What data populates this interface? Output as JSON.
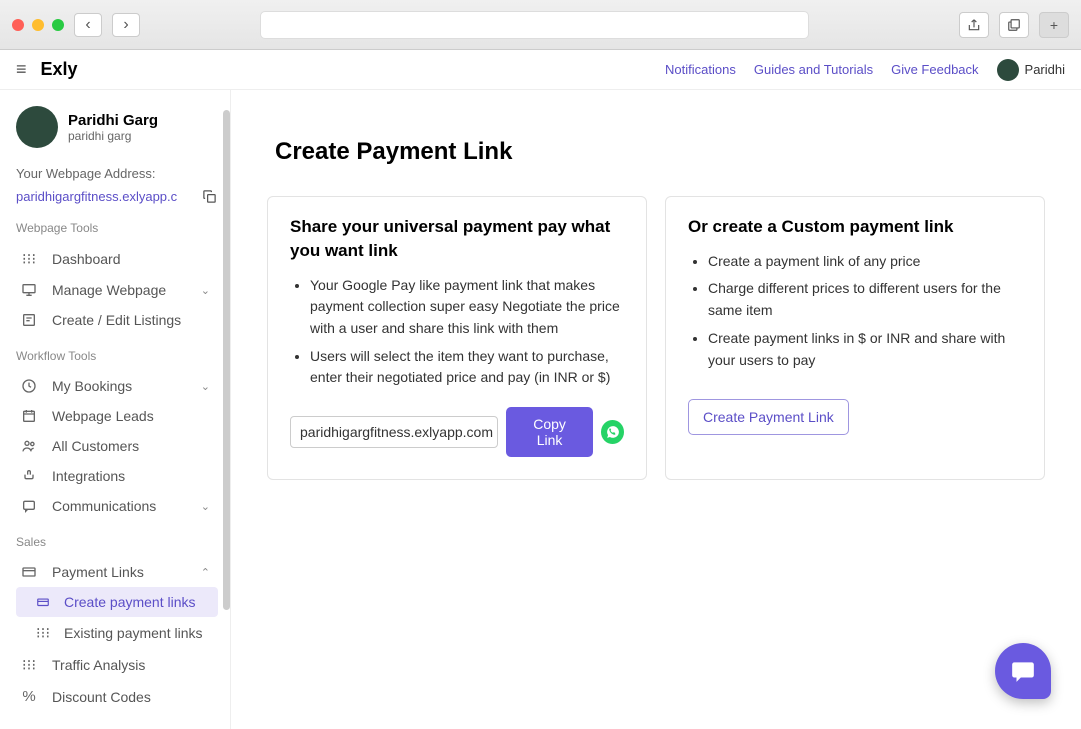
{
  "brand": "Exly",
  "topbar": {
    "links": [
      "Notifications",
      "Guides and Tutorials",
      "Give Feedback"
    ],
    "user": "Paridhi"
  },
  "sidebar": {
    "profile": {
      "name": "Paridhi Garg",
      "sub": "paridhi garg"
    },
    "addr_label": "Your Webpage Address:",
    "addr_link": "paridhigargfitness.exlyapp.c",
    "groups": [
      {
        "title": "Webpage Tools",
        "items": [
          {
            "label": "Dashboard",
            "icon": "sliders"
          },
          {
            "label": "Manage Webpage",
            "icon": "monitor",
            "chevron": "down"
          },
          {
            "label": "Create / Edit Listings",
            "icon": "post"
          }
        ]
      },
      {
        "title": "Workflow Tools",
        "items": [
          {
            "label": "My Bookings",
            "icon": "clock",
            "chevron": "down"
          },
          {
            "label": "Webpage Leads",
            "icon": "calendar"
          },
          {
            "label": "All Customers",
            "icon": "people"
          },
          {
            "label": "Integrations",
            "icon": "link"
          },
          {
            "label": "Communications",
            "icon": "chat",
            "chevron": "down"
          }
        ]
      },
      {
        "title": "Sales",
        "items": [
          {
            "label": "Payment Links",
            "icon": "card",
            "chevron": "up",
            "sub": [
              {
                "label": "Create payment links",
                "icon": "card-sm",
                "active": true
              },
              {
                "label": "Existing payment links",
                "icon": "sliders"
              }
            ]
          },
          {
            "label": "Traffic Analysis",
            "icon": "sliders"
          },
          {
            "label": "Discount Codes",
            "icon": "percent"
          }
        ]
      }
    ]
  },
  "main": {
    "title": "Create Payment Link",
    "card1": {
      "title": "Share your universal payment pay what you want link",
      "bullets": [
        "Your Google Pay like payment link that makes payment collection super easy Negotiate the price with a user and share this link with them",
        "Users will select the item they want to purchase, enter their negotiated price and pay (in INR or $)"
      ],
      "link_value": "paridhigargfitness.exlyapp.com",
      "copy_btn": "Copy Link"
    },
    "card2": {
      "title": "Or create a Custom payment link",
      "bullets": [
        "Create a payment link of any price",
        "Charge different prices to different users for the same item",
        "Create payment links in $ or INR and share with your users to pay"
      ],
      "create_btn": "Create Payment Link"
    }
  }
}
